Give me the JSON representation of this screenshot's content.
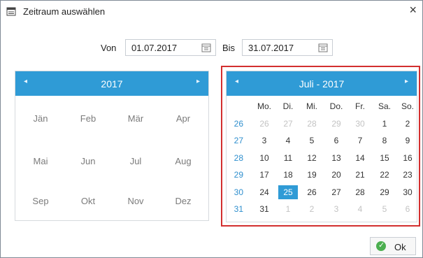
{
  "window": {
    "title": "Zeitraum auswählen",
    "close_glyph": "×"
  },
  "range": {
    "from_label": "Von",
    "from_value": "01.07.2017",
    "to_label": "Bis",
    "to_value": "31.07.2017"
  },
  "year_panel": {
    "title": "2017",
    "months": [
      "Jän",
      "Feb",
      "Mär",
      "Apr",
      "Mai",
      "Jun",
      "Jul",
      "Aug",
      "Sep",
      "Okt",
      "Nov",
      "Dez"
    ]
  },
  "month_panel": {
    "title": "Juli - 2017",
    "weekdays": [
      "Mo.",
      "Di.",
      "Mi.",
      "Do.",
      "Fr.",
      "Sa.",
      "So."
    ],
    "weeks": [
      "26",
      "27",
      "28",
      "29",
      "30",
      "31"
    ],
    "rows": [
      [
        "26",
        "27",
        "28",
        "29",
        "30",
        "1",
        "2"
      ],
      [
        "3",
        "4",
        "5",
        "6",
        "7",
        "8",
        "9"
      ],
      [
        "10",
        "11",
        "12",
        "13",
        "14",
        "15",
        "16"
      ],
      [
        "17",
        "18",
        "19",
        "20",
        "21",
        "22",
        "23"
      ],
      [
        "24",
        "25",
        "26",
        "27",
        "28",
        "29",
        "30"
      ],
      [
        "31",
        "1",
        "2",
        "3",
        "4",
        "5",
        "6"
      ]
    ],
    "selected_day": "25"
  },
  "ok_label": "Ok",
  "colors": {
    "accent": "#2f9bd6",
    "highlight_border": "#d32f2f"
  }
}
